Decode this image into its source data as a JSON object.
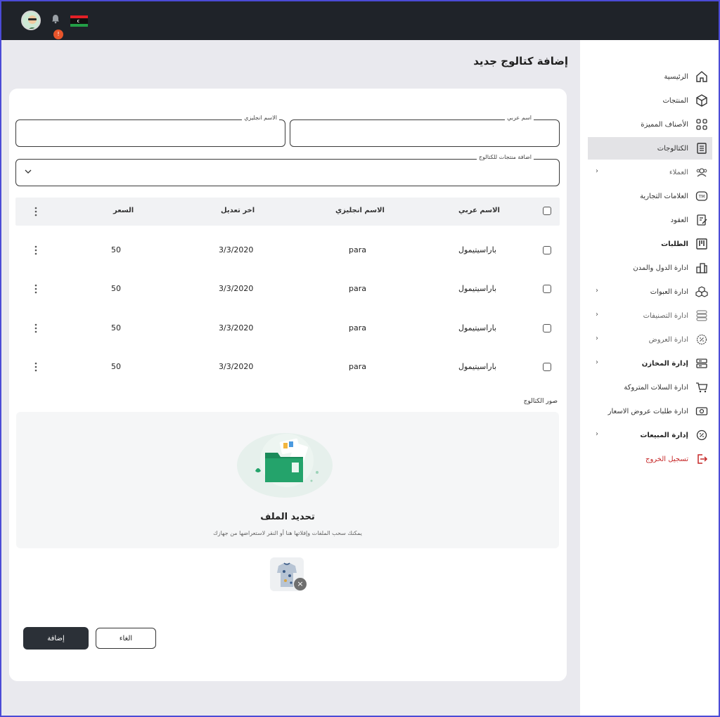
{
  "topbar": {
    "notification_count": "!"
  },
  "page": {
    "title": "إضافة كتالوج جديد"
  },
  "form": {
    "arabic_name_label": "اسم عربي",
    "english_name_label": "الاسم انجليزي",
    "add_products_label": "اضافة منتجات للكتالوج"
  },
  "table": {
    "headers": {
      "arabic_name": "الاسم عربي",
      "english_name": "الاسم انجليزي",
      "last_modified": "اخر تعديل",
      "price": "السعر"
    },
    "rows": [
      {
        "arabic_name": "باراسيتيمول",
        "english_name": "para",
        "last_modified": "3/3/2020",
        "price": "50"
      },
      {
        "arabic_name": "باراسيتيمول",
        "english_name": "para",
        "last_modified": "3/3/2020",
        "price": "50"
      },
      {
        "arabic_name": "باراسيتيمول",
        "english_name": "para",
        "last_modified": "3/3/2020",
        "price": "50"
      },
      {
        "arabic_name": "باراسيتيمول",
        "english_name": "para",
        "last_modified": "3/3/2020",
        "price": "50"
      }
    ]
  },
  "images": {
    "section_label": "صور الكتالوج",
    "dropzone_title": "تحديد الملف",
    "dropzone_subtitle": "يمكنك سحب الملفات وإفلاتها هنا أو النقر لاستعراضها من جهازك"
  },
  "actions": {
    "cancel_label": "الغاء",
    "add_label": "إضافة"
  },
  "sidebar": {
    "items": [
      {
        "label": "الرئيسية",
        "icon": "home-icon"
      },
      {
        "label": "المنتجات",
        "icon": "box-icon"
      },
      {
        "label": "الأصناف المميزة",
        "icon": "grid-icon"
      },
      {
        "label": "الكتالوجات",
        "icon": "document-icon",
        "active": true
      },
      {
        "label": "العملاء",
        "icon": "users-icon",
        "has_submenu": true
      },
      {
        "label": "العلامات التجارية",
        "icon": "trademark-icon"
      },
      {
        "label": "العقود",
        "icon": "contract-icon"
      },
      {
        "label": "الطلبات",
        "icon": "kanban-icon"
      },
      {
        "label": "ادارة الدول والمدن",
        "icon": "city-icon"
      },
      {
        "label": "ادارة العبوات",
        "icon": "packages-icon",
        "has_submenu": true
      },
      {
        "label": "ادارة التصنيفات",
        "icon": "layers-icon",
        "has_submenu": true
      },
      {
        "label": "ادارة العروض",
        "icon": "offer-icon",
        "has_submenu": true
      },
      {
        "label": "إدارة المخازن",
        "icon": "warehouse-icon",
        "has_submenu": true
      },
      {
        "label": "ادارة السلات المتروكة",
        "icon": "cart-icon"
      },
      {
        "label": "ادارة طلبات عروض الاسعار",
        "icon": "price-request-icon"
      },
      {
        "label": "إدارة المبيعات",
        "icon": "sales-icon",
        "has_submenu": true
      },
      {
        "label": "تسجيل الخروج",
        "icon": "logout-icon"
      }
    ]
  },
  "colors": {
    "topbar": "#1f2329",
    "primary_button": "#2b3037",
    "logout": "#c62828",
    "badge": "#e8552b",
    "accent_green": "#1b8a5a"
  }
}
